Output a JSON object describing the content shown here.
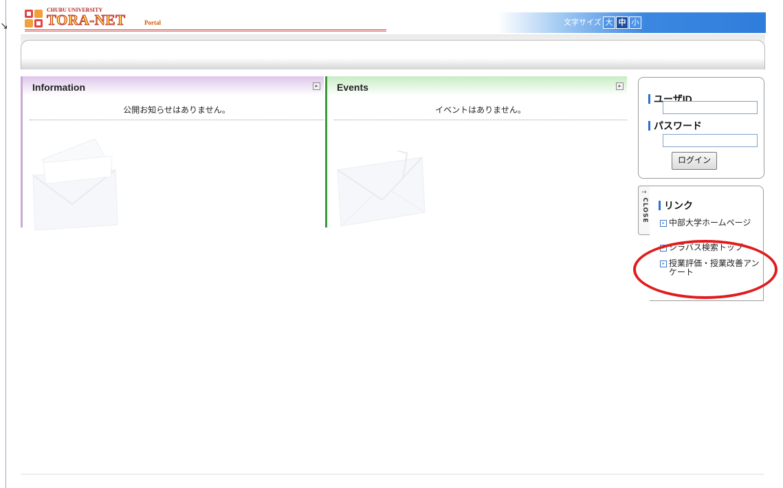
{
  "header": {
    "logo_small": "CHUBU UNIVERSITY",
    "logo_main": "TORA-NET",
    "logo_portal": "Portal",
    "font_size_label": "文字サイズ",
    "font_size_large": "大",
    "font_size_medium": "中",
    "font_size_small": "小"
  },
  "panels": {
    "information": {
      "title": "Information",
      "message": "公開お知らせはありません。"
    },
    "events": {
      "title": "Events",
      "message": "イベントはありません。"
    }
  },
  "login": {
    "user_id_label": "ユーザID",
    "password_label": "パスワード",
    "button_label": "ログイン"
  },
  "links": {
    "close_tab": "CLOSE",
    "title": "リンク",
    "items": [
      {
        "label": "中部大学ホームページ"
      },
      {
        "label": "シラバス検索トップ"
      },
      {
        "label": "授業評価・授業改善アンケート"
      }
    ]
  },
  "colors": {
    "info_accent": "#c9a8d8",
    "events_accent": "#3a9a3a",
    "highlight_circle": "#e01c1c",
    "label_bar": "#2e6fd2"
  }
}
